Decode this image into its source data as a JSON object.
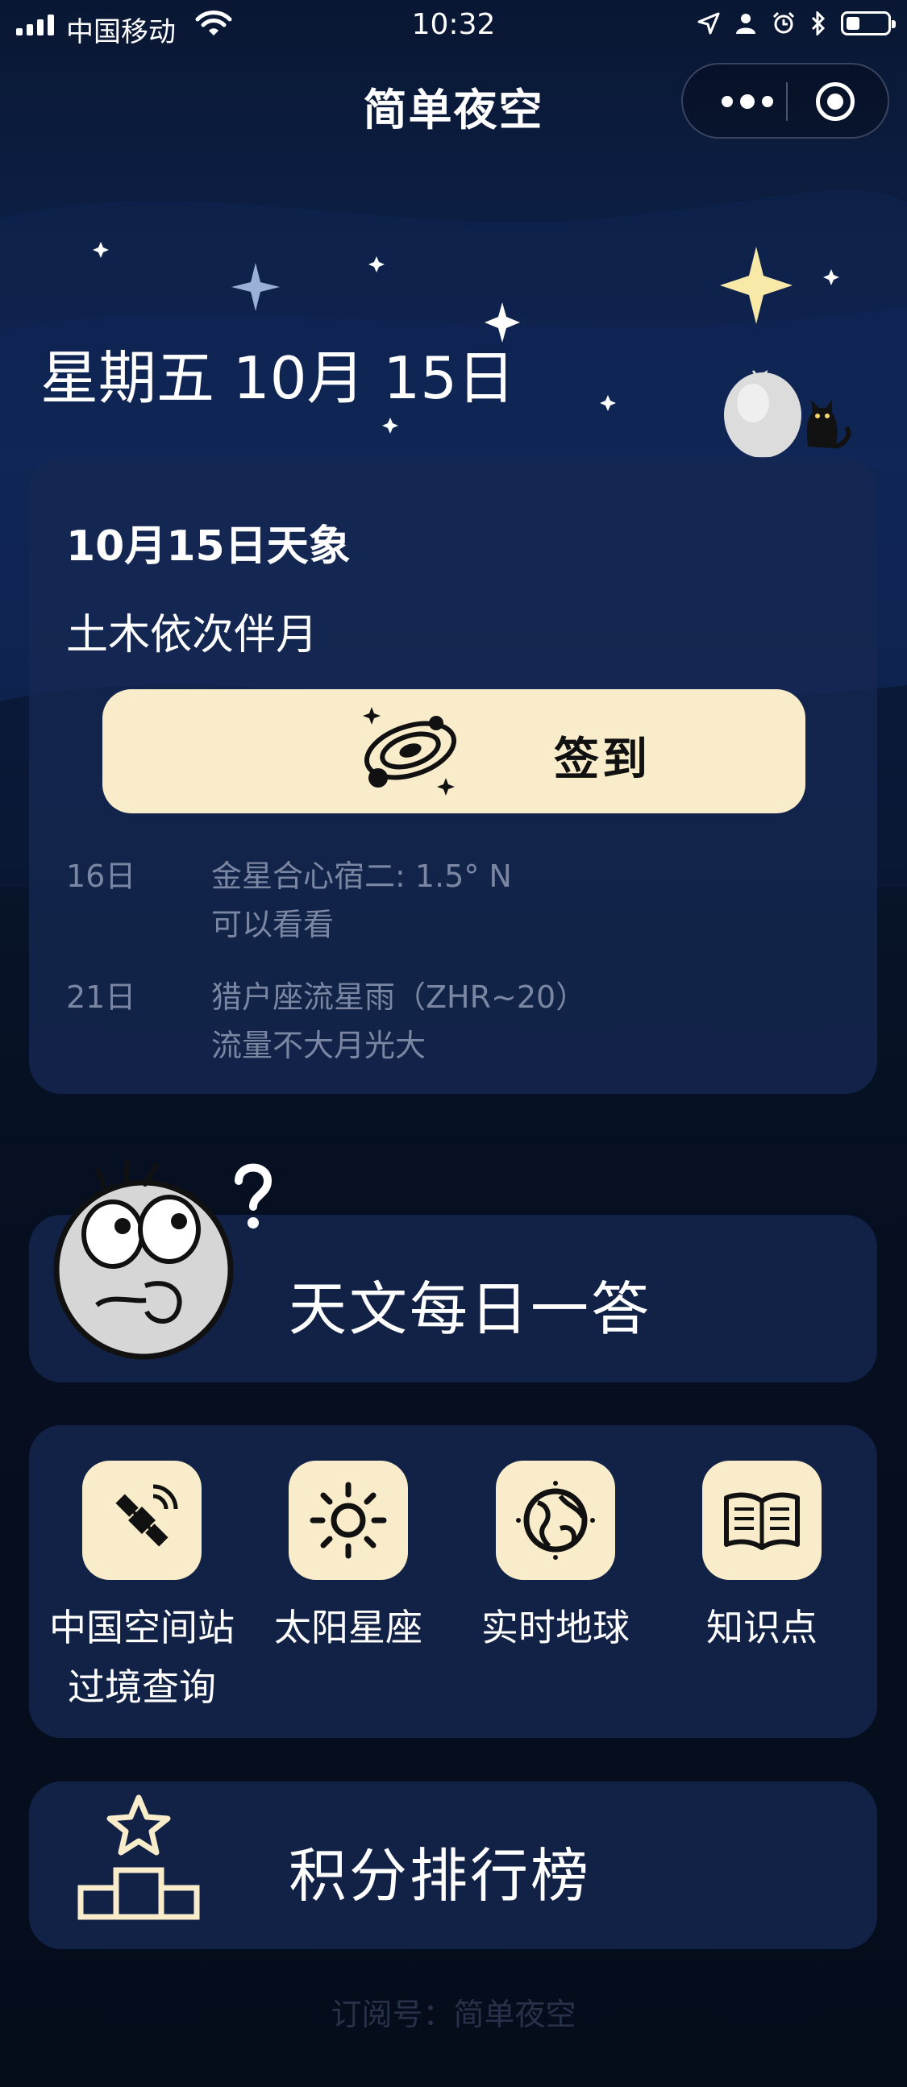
{
  "status_bar": {
    "carrier": "中国移动",
    "time": "10:32",
    "icons": [
      "signal-icon",
      "wifi-icon",
      "location-arrow-icon",
      "person-icon",
      "alarm-icon",
      "bluetooth-icon",
      "battery-icon"
    ],
    "battery_level": 0.2
  },
  "nav": {
    "title": "简单夜空",
    "more_icon": "more-dots-icon",
    "close_icon": "target-circle-icon"
  },
  "date_title": "星期五 10月 15日",
  "today": {
    "heading": "10月15日天象",
    "summary": "土木依次伴月",
    "checkin_label": "签到",
    "checkin_icon": "galaxy-icon",
    "events": [
      {
        "day": "16日",
        "lines": [
          "金星合心宿二: 1.5° N",
          "可以看看"
        ]
      },
      {
        "day": "21日",
        "lines": [
          "猎户座流星雨（ZHR~20）",
          "流量不大月光大"
        ]
      }
    ]
  },
  "daily_qa": {
    "label": "天文每日一答",
    "mascot_icon": "thinking-mascot-icon"
  },
  "tools": [
    {
      "label": "中国空间站",
      "label2": "过境查询",
      "icon": "satellite-icon"
    },
    {
      "label": "太阳星座",
      "label2": "",
      "icon": "sun-icon"
    },
    {
      "label": "实时地球",
      "label2": "",
      "icon": "earth-icon"
    },
    {
      "label": "知识点",
      "label2": "",
      "icon": "open-book-icon"
    }
  ],
  "ranking": {
    "label": "积分排行榜",
    "icon": "podium-star-icon"
  },
  "footer": "订阅号：简单夜空",
  "colors": {
    "accent": "#f8ecca",
    "card": "#16284f",
    "muted_text": "#7b86a3",
    "background": "#06101f"
  }
}
